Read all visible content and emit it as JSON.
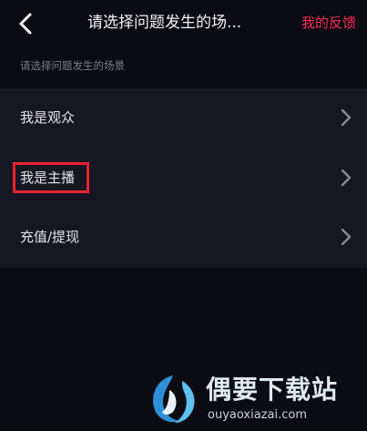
{
  "header": {
    "back_icon": "chevron-left-icon",
    "title": "请选择问题发生的场...",
    "feedback_label": "我的反馈",
    "feedback_color": "#fe2c55"
  },
  "section_hint": "请选择问题发生的场景",
  "list": {
    "items": [
      {
        "label": "我是观众",
        "icon": "chevron-right-icon"
      },
      {
        "label": "我是主播",
        "icon": "chevron-right-icon",
        "highlighted": true
      },
      {
        "label": "充值/提现",
        "icon": "chevron-right-icon"
      }
    ]
  },
  "annotation": {
    "color": "#e8232f"
  },
  "watermark": {
    "name": "偶要下载站",
    "url": "ouyaoxiazai.com"
  }
}
